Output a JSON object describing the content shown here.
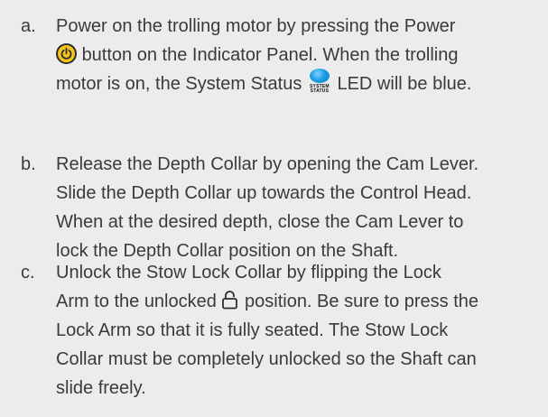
{
  "steps": [
    {
      "marker": "a.",
      "lines": [
        "Power on the trolling motor by pressing the Power",
        "button on the Indicator Panel. When the trolling",
        "motor is on, the System Status",
        "LED will be blue."
      ]
    },
    {
      "marker": "b.",
      "lines": [
        "Release the Depth Collar by opening the Cam Lever.",
        "Slide the Depth Collar up towards the Control Head.",
        "When at the desired depth, close the Cam Lever to",
        "lock the Depth Collar position on the Shaft."
      ]
    },
    {
      "marker": "c.",
      "lines": [
        "Unlock the Stow Lock Collar by flipping the Lock",
        "Arm to the unlocked",
        "position. Be sure to press the",
        "Lock Arm so that it is fully seated. The Stow Lock",
        "Collar must be completely unlocked so the Shaft can",
        "slide freely."
      ]
    }
  ],
  "icons": {
    "power": "power-icon",
    "status_led": "system-status-led-icon",
    "status_led_label_top": "SYSTEM",
    "status_led_label_bottom": "STATUS",
    "lock": "unlocked-padlock-icon"
  },
  "colors": {
    "background": "#ececec",
    "text": "#3a3a3a",
    "power_button": "#f6c51c",
    "status_led": "#1ca0e6"
  }
}
